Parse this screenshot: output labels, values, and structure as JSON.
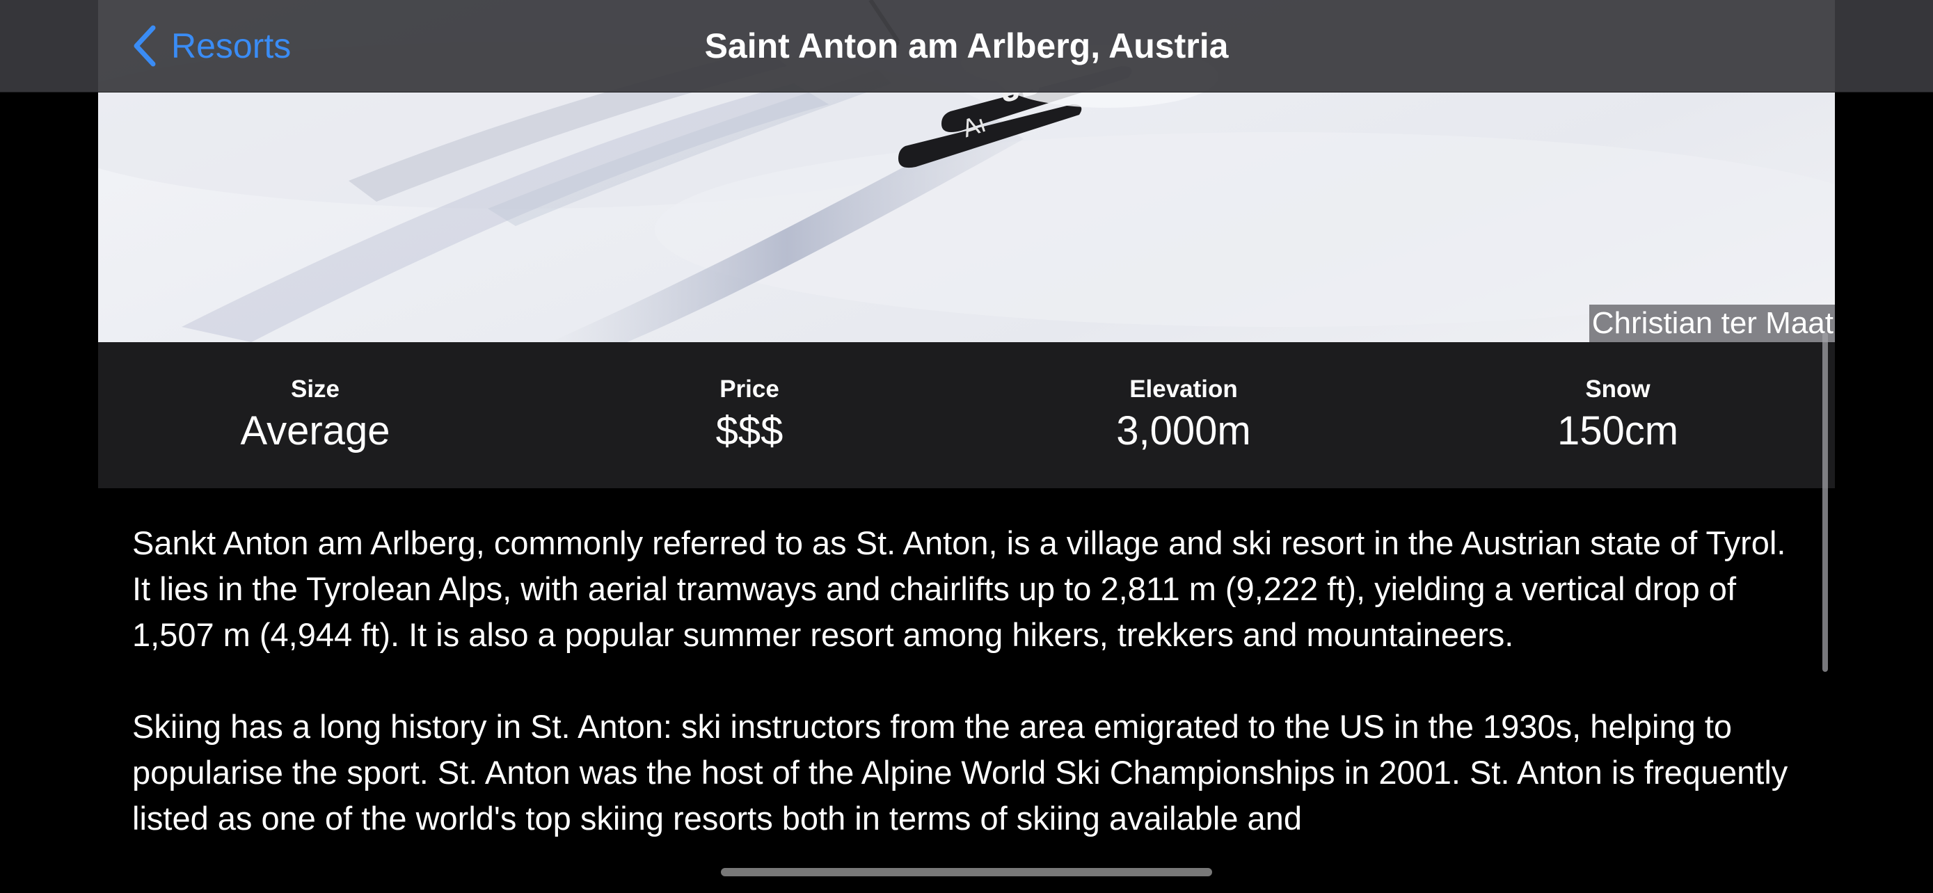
{
  "navigation": {
    "back_label": "Resorts",
    "title": "Saint Anton am Arlberg, Austria",
    "accent_color": "#3a8cf5"
  },
  "hero": {
    "photo_credit": "Christian ter Maat"
  },
  "stats": [
    {
      "label": "Size",
      "value": "Average"
    },
    {
      "label": "Price",
      "value": "$$$"
    },
    {
      "label": "Elevation",
      "value": "3,000m"
    },
    {
      "label": "Snow",
      "value": "150cm"
    }
  ],
  "description": {
    "paragraphs": [
      "Sankt Anton am Arlberg, commonly referred to as St. Anton, is a village and ski resort in the Austrian state of Tyrol. It lies in the Tyrolean Alps, with aerial tramways and chairlifts up to 2,811 m (9,222 ft), yielding a vertical drop of 1,507 m (4,944 ft). It is also a popular summer resort among hikers, trekkers and mountaineers.",
      "Skiing has a long history in St. Anton: ski instructors from the area emigrated to the US in the 1930s, helping to popularise the sport. St. Anton was the host of the Alpine World Ski Championships in 2001. St. Anton is frequently listed as one of the world's top skiing resorts both in terms of skiing available and"
    ]
  },
  "icons": {
    "back": "chevron-left-icon"
  }
}
